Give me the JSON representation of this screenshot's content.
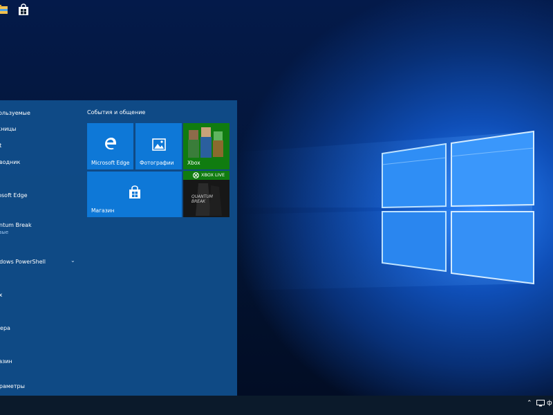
{
  "start_menu": {
    "list_header": "ользуемые",
    "apps": [
      "жницы",
      "nt",
      "оводник",
      "rosoft Edge",
      "antum Break",
      "ndows PowerShell",
      "ox",
      "мера",
      "газин",
      "араметры"
    ],
    "app_sub": "овые",
    "group_title": "События и общение",
    "tiles": {
      "edge": "Microsoft Edge",
      "photos": "Фотографии",
      "xbox": "Xbox",
      "store": "Магазин",
      "xbox_live_badge": "XBOX LIVE",
      "quantum": "QUANTUM BREAK"
    }
  },
  "taskbar": {
    "tray_text": "ф"
  },
  "colors": {
    "start_bg": "#104c88",
    "tile_blue": "#0e78d7",
    "xbox_green": "#107c10",
    "taskbar": "#0b1a2b"
  },
  "icons": [
    "edge-icon",
    "photos-icon",
    "store-icon",
    "xbox-logo-icon",
    "file-explorer-icon",
    "store-taskbar-icon",
    "chevron-up-icon",
    "network-icon",
    "chevron-down-icon"
  ]
}
